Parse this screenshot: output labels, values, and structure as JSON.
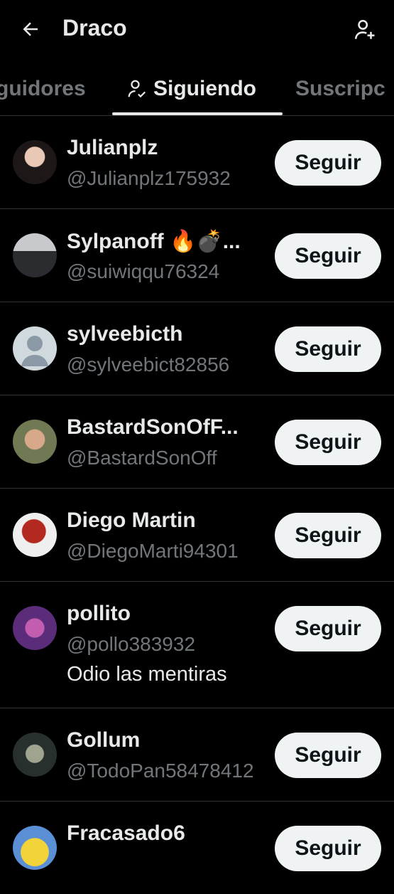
{
  "header": {
    "title": "Draco",
    "back_icon": "arrow-left-icon",
    "add_icon": "add-person-icon"
  },
  "tabs": [
    {
      "label": "guidores",
      "active": false
    },
    {
      "label": "Siguiendo",
      "active": true,
      "icon": "person-check-icon"
    },
    {
      "label": "Suscripc",
      "active": false
    }
  ],
  "accounts": [
    {
      "name": "Julianplz",
      "handle": "@Julianplz175932",
      "button": "Seguir",
      "avatar_color": "#3a2d2b"
    },
    {
      "name": "Sylpanoff 🔥💣...",
      "handle": "@suiwiqqu76324",
      "button": "Seguir",
      "avatar_color": "#6a6d73"
    },
    {
      "name": "sylveebicth",
      "handle": "@sylveebict82856",
      "button": "Seguir",
      "avatar_color": "#cfd9de"
    },
    {
      "name": "BastardSonOfF...",
      "handle": "@BastardSonOff",
      "button": "Seguir",
      "avatar_color": "#5c6a48"
    },
    {
      "name": "Diego Martin",
      "handle": "@DiegoMarti94301",
      "button": "Seguir",
      "avatar_color": "#8e2a24"
    },
    {
      "name": "pollito",
      "handle": "@pollo383932",
      "bio": "Odio las mentiras",
      "button": "Seguir",
      "avatar_color": "#7a2f6e"
    },
    {
      "name": "Gollum",
      "handle": "@TodoPan58478412",
      "button": "Seguir",
      "avatar_color": "#4a5450"
    },
    {
      "name": "Fracasado6",
      "handle": "",
      "button": "Seguir",
      "avatar_color": "#f2d43a"
    }
  ]
}
